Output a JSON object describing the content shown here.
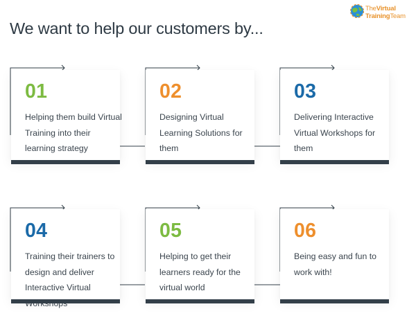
{
  "page": {
    "title": "We want to help our customers by..."
  },
  "logo": {
    "line1_a": "The",
    "line1_b": "Virtual",
    "line2_a": "Training",
    "line2_b": "Team",
    "colors": {
      "orange": "#e8922b",
      "blue": "#2b8fd6",
      "green": "#7bbf3f"
    }
  },
  "cards": [
    {
      "number": "01",
      "text": "Helping them build Virtual Training into their learning strategy",
      "color": "#7dbb42"
    },
    {
      "number": "02",
      "text": "Designing Virtual Learning Solutions for them",
      "color": "#ee8f2d"
    },
    {
      "number": "03",
      "text": "Delivering Interactive Virtual Workshops for them",
      "color": "#1b6aa8"
    },
    {
      "number": "04",
      "text": "Training their trainers to design and deliver Interactive Virtual Workshops",
      "color": "#1b6aa8"
    },
    {
      "number": "05",
      "text": "Helping to get their learners ready for the virtual world",
      "color": "#7dbb42"
    },
    {
      "number": "06",
      "text": "Being easy and fun to work with!",
      "color": "#ee8f2d"
    }
  ],
  "accent_colors": {
    "bar": "#333f49",
    "connector": "#333f49"
  }
}
